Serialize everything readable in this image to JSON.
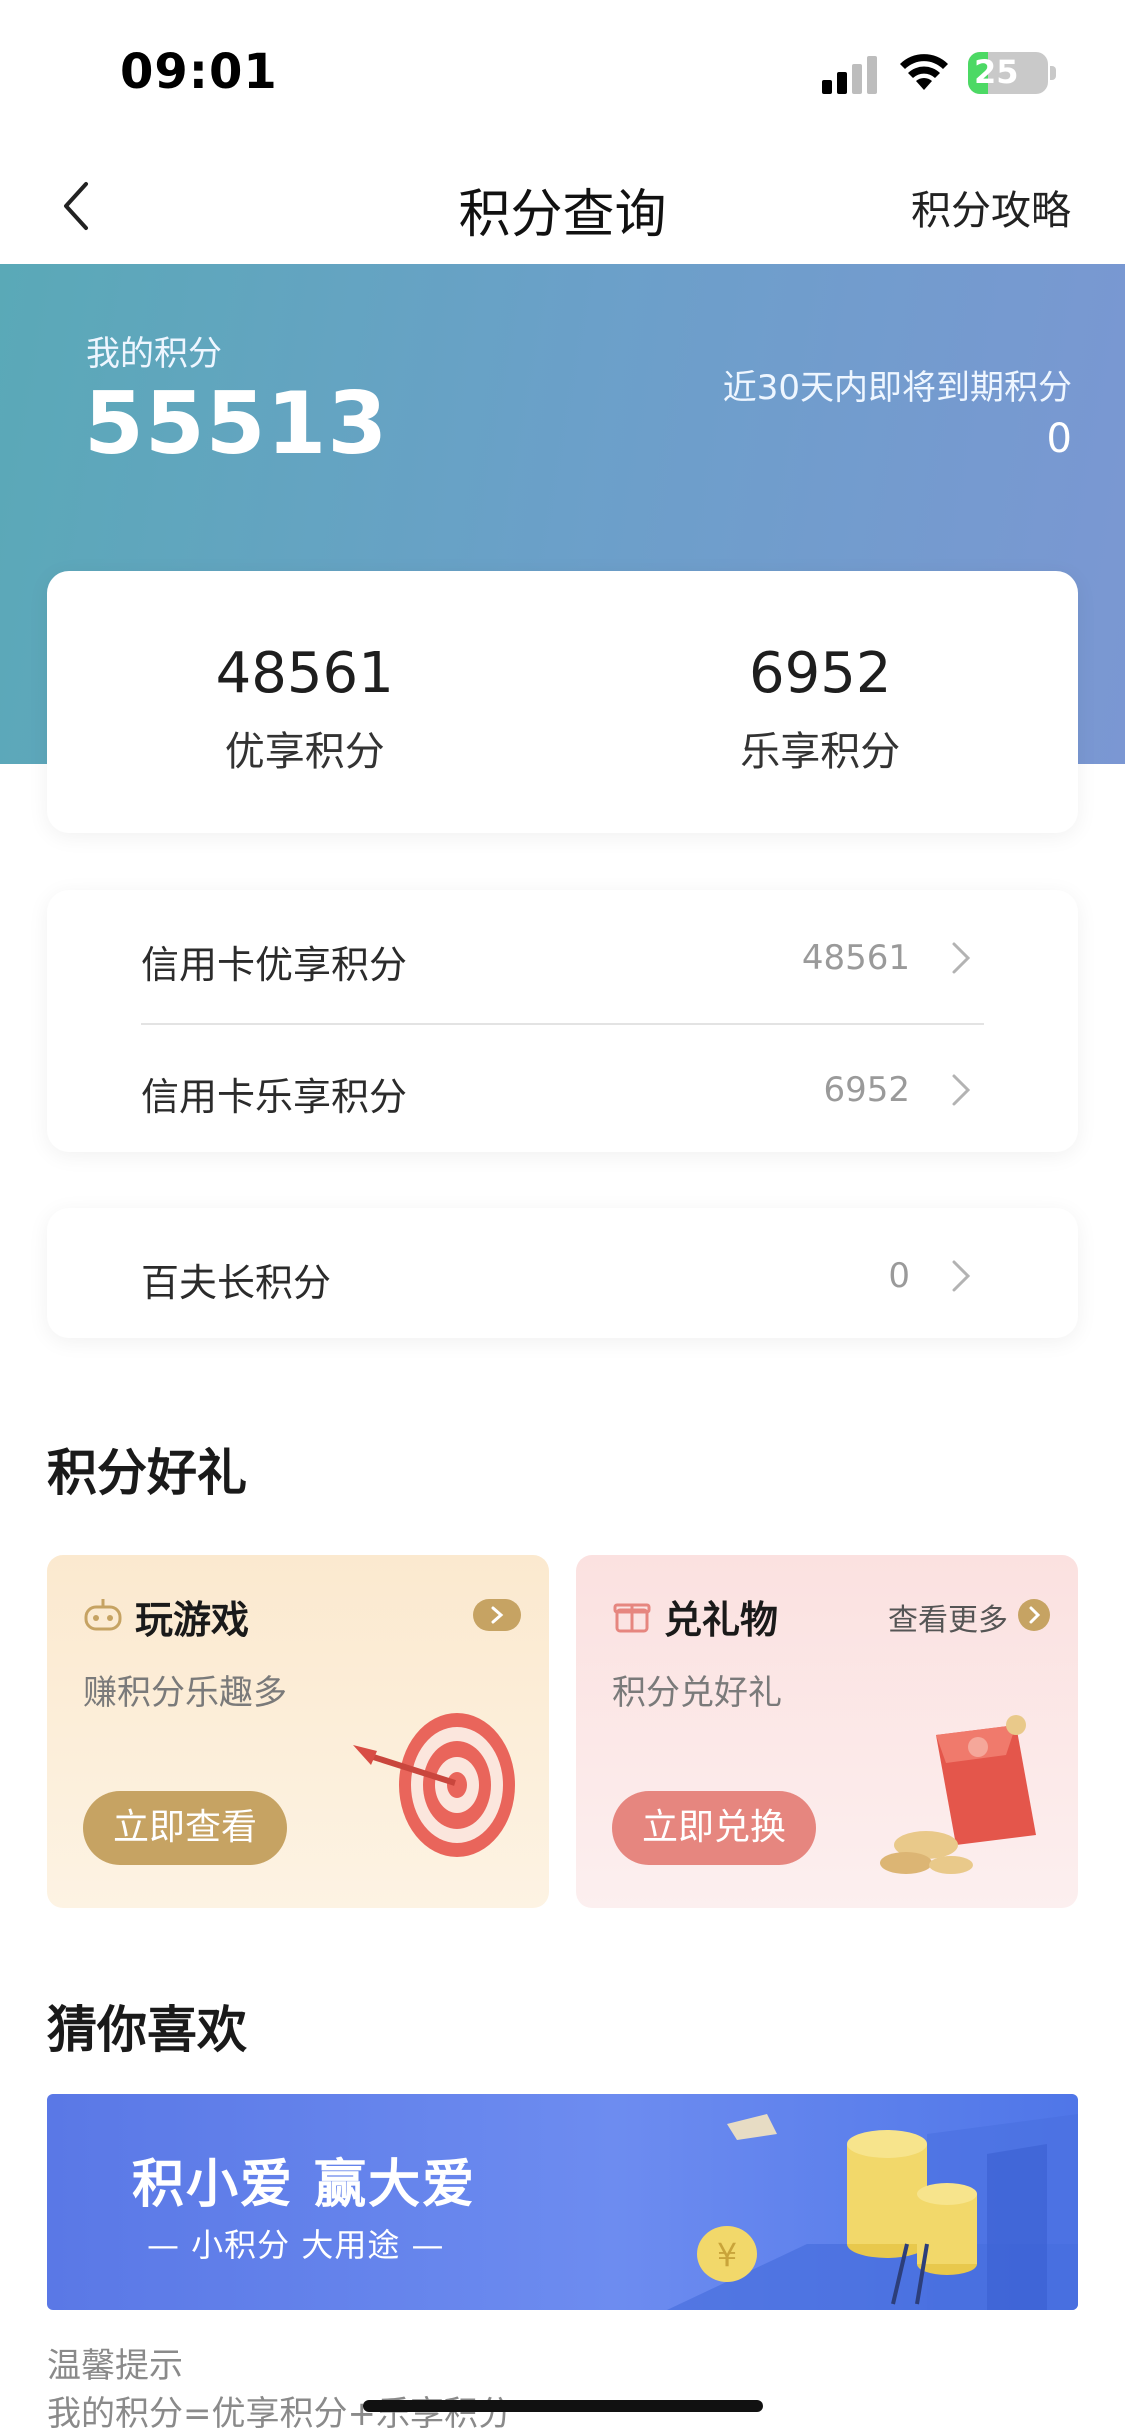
{
  "status_bar": {
    "time": "09:01",
    "battery": "25",
    "battery_level": 0.25
  },
  "nav": {
    "title": "积分查询",
    "right_link": "积分攻略"
  },
  "summary": {
    "my_points_label": "我的积分",
    "my_points_value": "55513",
    "expiring_label": "近30天内即将到期积分",
    "expiring_value": "0"
  },
  "split": [
    {
      "value": "48561",
      "label": "优享积分"
    },
    {
      "value": "6952",
      "label": "乐享积分"
    }
  ],
  "credit_list": [
    {
      "label": "信用卡优享积分",
      "value": "48561"
    },
    {
      "label": "信用卡乐享积分",
      "value": "6952"
    }
  ],
  "other_list": [
    {
      "label": "百夫长积分",
      "value": "0"
    }
  ],
  "gifts_section": {
    "title": "积分好礼",
    "game": {
      "title": "玩游戏",
      "subtitle": "赚积分乐趣多",
      "button": "立即查看"
    },
    "gift": {
      "title": "兑礼物",
      "subtitle": "积分兑好礼",
      "button": "立即兑换",
      "more": "查看更多"
    }
  },
  "recommend_section": {
    "title": "猜你喜欢",
    "banner_title": "积小爱 赢大爱",
    "banner_subtitle": "— 小积分 大用途 —"
  },
  "tips": {
    "title": "温馨提示",
    "text": "我的积分=优享积分+乐享积分"
  },
  "colors": {
    "accent_gold": "#c6a363",
    "accent_red": "#e6867f",
    "hero_start": "#5aa9b7",
    "hero_end": "#7b97d3"
  }
}
